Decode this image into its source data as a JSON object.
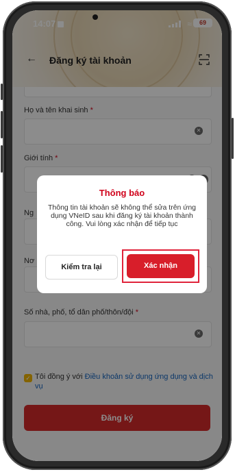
{
  "status_bar": {
    "time": "14:07",
    "battery": "69"
  },
  "header": {
    "title": "Đăng ký tài khoản"
  },
  "form": {
    "full_name_label": "Họ và tên khai sinh",
    "gender_label": "Giới tính",
    "partial_label_1": "Ng",
    "partial_label_2": "Nơ",
    "address_label": "Số nhà, phố, tổ dân phố/thôn/đội",
    "required_mark": "*",
    "agree_prefix": "Tôi đồng ý với ",
    "agree_link": "Điều khoản sử dụng ứng dụng và dịch vụ",
    "submit_label": "Đăng ký"
  },
  "dialog": {
    "title": "Thông báo",
    "message": "Thông tin tài khoản sẽ không thể sửa trên ứng dụng VNeID sau khi đăng ký tài khoản thành công. Vui lòng xác nhận để tiếp tục",
    "check_label": "Kiểm tra lại",
    "confirm_label": "Xác nhận"
  },
  "icons": [
    "back-arrow-icon",
    "scan-icon",
    "clear-icon",
    "chevron-down-icon",
    "checkbox-icon",
    "wifi-icon",
    "signal-icon",
    "battery-icon"
  ],
  "colors": {
    "brand_red": "#d81e2a",
    "highlight_red": "#e0223a",
    "checkbox_yellow": "#f0b400",
    "link_blue": "#1565c0"
  }
}
